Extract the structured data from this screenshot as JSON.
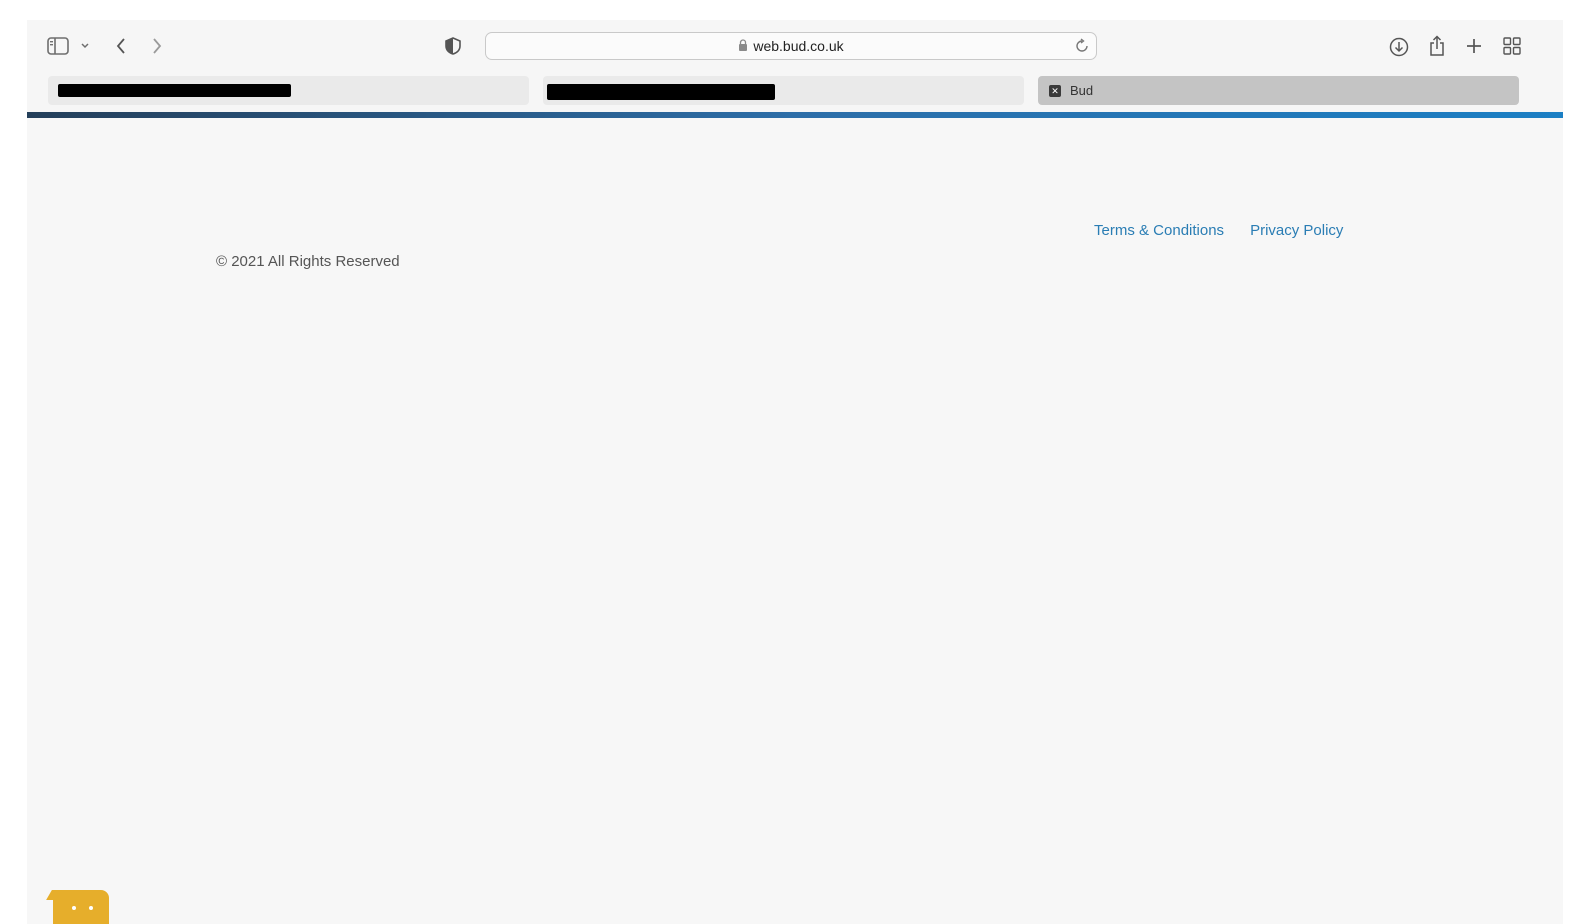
{
  "browser": {
    "url": "web.bud.co.uk",
    "tabs": [
      {
        "label": "",
        "redacted": true,
        "active": false
      },
      {
        "label": "",
        "redacted": true,
        "active": false
      },
      {
        "label": "Bud",
        "redacted": false,
        "active": true
      }
    ]
  },
  "footer": {
    "links": {
      "terms": "Terms & Conditions",
      "privacy": "Privacy Policy"
    },
    "copyright": "© 2021 All Rights Reserved"
  },
  "theme": {
    "accent": "#2d6ea8",
    "link": "#2a7db4",
    "chat_widget": "#e6ae2b"
  },
  "icons": {
    "sidebar": "sidebar-icon",
    "back": "chevron-left-icon",
    "forward": "chevron-right-icon",
    "privacy_shield": "shield-icon",
    "lock": "lock-icon",
    "reload": "reload-icon",
    "download": "download-icon",
    "share": "share-icon",
    "new_tab": "plus-icon",
    "tab_overview": "grid-icon",
    "chat": "chat-icon"
  }
}
